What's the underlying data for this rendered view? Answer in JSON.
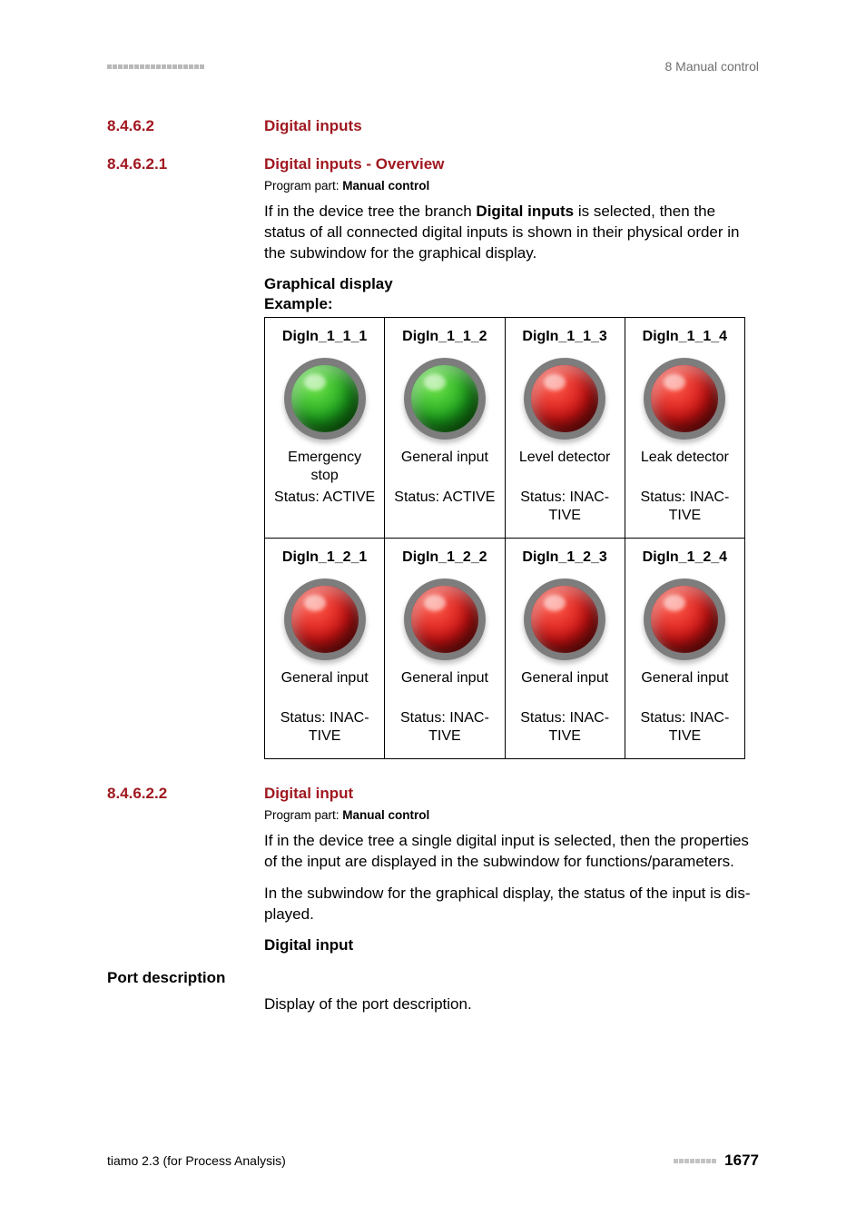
{
  "header": {
    "breadcrumb": "8 Manual control"
  },
  "sections": {
    "s1": {
      "num": "8.4.6.2",
      "title": "Digital inputs"
    },
    "s2": {
      "num": "8.4.6.2.1",
      "title": "Digital inputs - Overview",
      "program_label": "Program part: ",
      "program_value": "Manual control",
      "para_pre": "If in the device tree the branch ",
      "para_bold": "Digital inputs",
      "para_post": " is selected, then the status of all connected digital inputs is shown in their physical order in the sub­window for the graphical display.",
      "gd": "Graphical display",
      "ex": "Example:"
    },
    "s3": {
      "num": "8.4.6.2.2",
      "title": "Digital input",
      "program_label": "Program part: ",
      "program_value": "Manual control",
      "p1": "If in the device tree a single digital input is selected, then the properties of the input are displayed in the subwindow for functions/parameters.",
      "p2": "In the subwindow for the graphical display, the status of the input is dis­played.",
      "h": "Digital input",
      "port_label": "Port description",
      "port_text": "Display of the port description."
    }
  },
  "table": {
    "rows": [
      [
        {
          "id": "DigIn_1_1_1",
          "color": "green",
          "desc": "Emergency stop",
          "status": "Status: ACTIVE"
        },
        {
          "id": "DigIn_1_1_2",
          "color": "green",
          "desc": "General input",
          "status": "Status: ACTIVE"
        },
        {
          "id": "DigIn_1_1_3",
          "color": "red",
          "desc": "Level detector",
          "status": "Status: INAC­TIVE"
        },
        {
          "id": "DigIn_1_1_4",
          "color": "red",
          "desc": "Leak detector",
          "status": "Status: INAC­TIVE"
        }
      ],
      [
        {
          "id": "DigIn_1_2_1",
          "color": "red",
          "desc": "General input",
          "status": "Status: INAC­TIVE"
        },
        {
          "id": "DigIn_1_2_2",
          "color": "red",
          "desc": "General input",
          "status": "Status: INAC­TIVE"
        },
        {
          "id": "DigIn_1_2_3",
          "color": "red",
          "desc": "General input",
          "status": "Status: INAC­TIVE"
        },
        {
          "id": "DigIn_1_2_4",
          "color": "red",
          "desc": "General input",
          "status": "Status: INAC­TIVE"
        }
      ]
    ]
  },
  "footer": {
    "left": "tiamo 2.3 (for Process Analysis)",
    "page": "1677"
  }
}
